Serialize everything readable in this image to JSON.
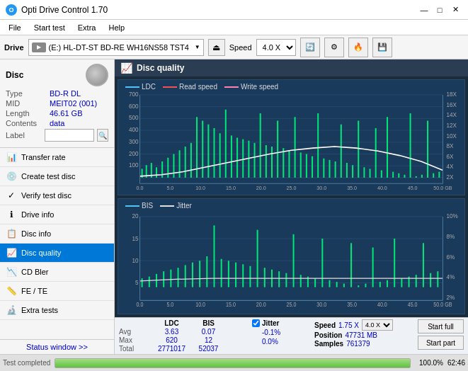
{
  "app": {
    "title": "Opti Drive Control 1.70",
    "icon": "O"
  },
  "titlebar": {
    "minimize": "—",
    "maximize": "□",
    "close": "✕"
  },
  "menubar": {
    "items": [
      "File",
      "Start test",
      "Extra",
      "Help"
    ]
  },
  "toolbar": {
    "drive_label": "Drive",
    "drive_value": "(E:)  HL-DT-ST BD-RE  WH16NS58 TST4",
    "speed_label": "Speed",
    "speed_value": "4.0 X"
  },
  "disc": {
    "title": "Disc",
    "type_label": "Type",
    "type_value": "BD-R DL",
    "mid_label": "MID",
    "mid_value": "MEIT02 (001)",
    "length_label": "Length",
    "length_value": "46.61 GB",
    "contents_label": "Contents",
    "contents_value": "data",
    "label_label": "Label",
    "label_value": ""
  },
  "sidebar": {
    "items": [
      {
        "id": "transfer-rate",
        "label": "Transfer rate",
        "icon": "📊"
      },
      {
        "id": "create-test-disc",
        "label": "Create test disc",
        "icon": "💿"
      },
      {
        "id": "verify-test-disc",
        "label": "Verify test disc",
        "icon": "✓"
      },
      {
        "id": "drive-info",
        "label": "Drive info",
        "icon": "ℹ"
      },
      {
        "id": "disc-info",
        "label": "Disc info",
        "icon": "📋"
      },
      {
        "id": "disc-quality",
        "label": "Disc quality",
        "icon": "📈",
        "active": true
      },
      {
        "id": "cd-bler",
        "label": "CD Bler",
        "icon": "📉"
      },
      {
        "id": "fe-te",
        "label": "FE / TE",
        "icon": "📏"
      },
      {
        "id": "extra-tests",
        "label": "Extra tests",
        "icon": "🔬"
      }
    ],
    "status_window": "Status window >>"
  },
  "disc_quality": {
    "title": "Disc quality",
    "legend": {
      "ldc": "LDC",
      "read_speed": "Read speed",
      "write_speed": "Write speed",
      "bis": "BIS",
      "jitter": "Jitter"
    },
    "chart1": {
      "y_max": 700,
      "y_labels": [
        "700",
        "600",
        "500",
        "400",
        "300",
        "200",
        "100"
      ],
      "y_right_labels": [
        "18X",
        "16X",
        "14X",
        "12X",
        "10X",
        "8X",
        "6X",
        "4X",
        "2X"
      ],
      "x_labels": [
        "0.0",
        "5.0",
        "10.0",
        "15.0",
        "20.0",
        "25.0",
        "30.0",
        "35.0",
        "40.0",
        "45.0",
        "50.0 GB"
      ]
    },
    "chart2": {
      "y_max": 20,
      "y_labels": [
        "20",
        "15",
        "10",
        "5"
      ],
      "y_right_labels": [
        "10%",
        "8%",
        "6%",
        "4%",
        "2%"
      ],
      "x_labels": [
        "0.0",
        "5.0",
        "10.0",
        "15.0",
        "20.0",
        "25.0",
        "30.0",
        "35.0",
        "40.0",
        "45.0",
        "50.0 GB"
      ]
    }
  },
  "stats": {
    "col_ldc": "LDC",
    "col_bis": "BIS",
    "col_jitter": "Jitter",
    "col_speed": "Speed",
    "col_position": "Position",
    "col_samples": "Samples",
    "row_avg_label": "Avg",
    "row_max_label": "Max",
    "row_total_label": "Total",
    "avg_ldc": "3.63",
    "avg_bis": "0.07",
    "avg_jitter": "-0.1%",
    "max_ldc": "620",
    "max_bis": "12",
    "max_jitter": "0.0%",
    "total_ldc": "2771017",
    "total_bis": "52037",
    "speed_value": "1.75 X",
    "speed_dropdown": "4.0 X",
    "position_value": "47731 MB",
    "samples_value": "761379",
    "jitter_checked": true,
    "start_full_label": "Start full",
    "start_part_label": "Start part"
  },
  "progress": {
    "status": "Test completed",
    "percent": "100.0%",
    "fill_width": "100",
    "time": "62:46"
  }
}
